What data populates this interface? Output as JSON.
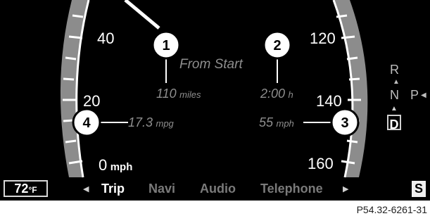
{
  "speedometer": {
    "speed_labels": [
      "40",
      "20",
      "0",
      "120",
      "140",
      "160"
    ],
    "unit": "mph"
  },
  "trip": {
    "from_start_label": "From Start",
    "distance_value": "110",
    "distance_unit": "miles",
    "time_value": "2:00",
    "time_unit": "h",
    "consumption_value": "17.3",
    "consumption_unit": "mpg",
    "avg_speed_value": "55",
    "avg_speed_unit": "mph"
  },
  "callouts": [
    "1",
    "2",
    "3",
    "4"
  ],
  "gear_indicator": {
    "reverse": "R",
    "neutral": "N",
    "park": "P",
    "drive": "D"
  },
  "status_bar": {
    "temperature_value": "72",
    "temperature_unit": "°F",
    "menu_tabs": [
      "Trip",
      "Navi",
      "Audio",
      "Telephone"
    ],
    "active_tab": "Trip",
    "s_indicator": "S"
  },
  "figure_reference": "P54.32-6261-31",
  "colors": {
    "background": "#000000",
    "dial_band": "#8c8c8c",
    "text_primary": "#ffffff",
    "text_secondary": "#8e8e8e",
    "inactive_tab": "#7a7a7a"
  },
  "icons": {
    "left_arrow": "left-arrow-icon",
    "right_arrow": "right-arrow-icon",
    "gear_arrow": "up-arrow-icon"
  }
}
